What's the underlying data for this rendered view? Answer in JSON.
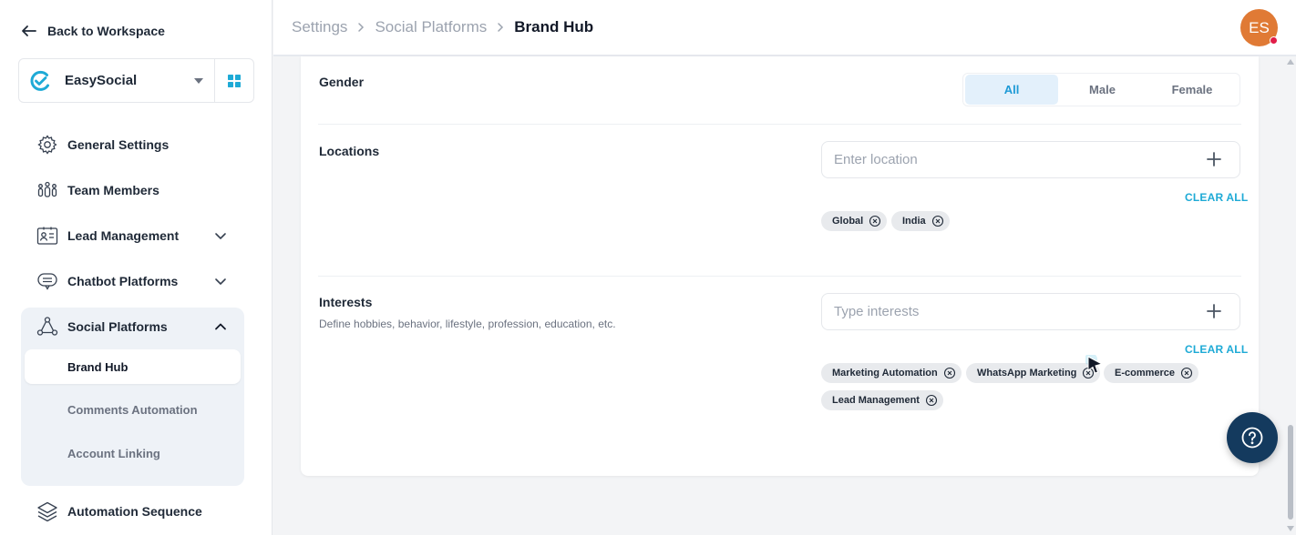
{
  "sidebar": {
    "back_label": "Back to Workspace",
    "workspace_name": "EasySocial",
    "items": [
      {
        "label": "General Settings"
      },
      {
        "label": "Team Members"
      },
      {
        "label": "Lead Management"
      },
      {
        "label": "Chatbot Platforms"
      },
      {
        "label": "Social Platforms"
      },
      {
        "label": "Automation Sequence"
      }
    ],
    "social_sub_items": [
      {
        "label": "Brand Hub",
        "active": true
      },
      {
        "label": "Comments Automation"
      },
      {
        "label": "Account Linking"
      }
    ]
  },
  "header": {
    "breadcrumb": [
      "Settings",
      "Social Platforms",
      "Brand Hub"
    ],
    "avatar_initials": "ES"
  },
  "gender": {
    "title": "Gender",
    "options": [
      "All",
      "Male",
      "Female"
    ],
    "selected": "All"
  },
  "locations": {
    "title": "Locations",
    "placeholder": "Enter location",
    "clear_label": "CLEAR ALL",
    "chips": [
      "Global",
      "India"
    ]
  },
  "interests": {
    "title": "Interests",
    "description": "Define hobbies, behavior, lifestyle, profession, education, etc.",
    "placeholder": "Type interests",
    "clear_label": "CLEAR ALL",
    "chips": [
      "Marketing Automation",
      "WhatsApp Marketing",
      "E-commerce",
      "Lead Management"
    ]
  },
  "colors": {
    "accent": "#1eaad6",
    "toggle_active_bg": "#e3f0fb",
    "avatar_bg": "#e07a35",
    "help_fab_bg": "#143a5e"
  },
  "icons": {
    "back": "arrow-left-icon",
    "workspace_logo": "easysocial-logo-icon",
    "apps": "grid-icon",
    "help": "question-icon"
  }
}
